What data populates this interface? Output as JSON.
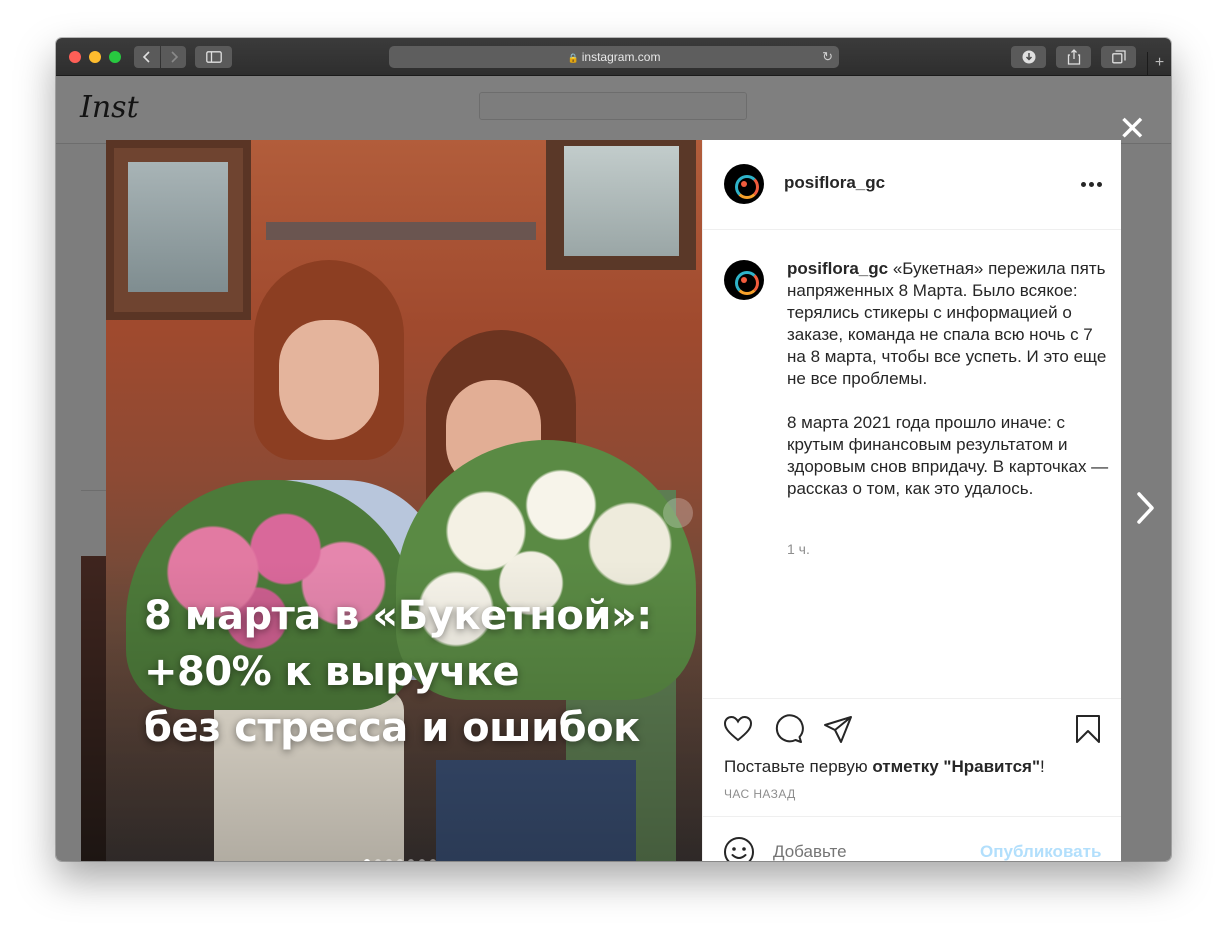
{
  "browser": {
    "url": "instagram.com"
  },
  "page": {
    "logo": "Inst"
  },
  "post": {
    "username": "posiflora_gc",
    "headline": [
      "8 марта в «Букетной»:",
      "+80% к выручке",
      "без стресса и ошибок"
    ],
    "carousel": {
      "total": 7,
      "active": 0
    },
    "caption_username": "posiflora_gc",
    "caption_paragraph1": " «Букетная» пережила пять напряженных 8 Марта. Было всякое: терялись стикеры с информацией о заказе, команда не спала всю ночь с 7 на 8 марта, чтобы все успеть. И это еще не все проблемы.",
    "caption_paragraph2": "8 марта 2021 года прошло иначе: с крутым финансовым результатом и здоровым снов впридачу. В карточках — рассказ о том, как это удалось.",
    "time_ago": "1 ч.",
    "likes_prefix": "Поставьте первую ",
    "likes_bold": "отметку \"Нравится\"",
    "likes_suffix": "!",
    "posted_time": "ЧАС НАЗАД",
    "comment_placeholder": "Добавьте",
    "publish_label": "Опубликовать"
  },
  "icons": {
    "close": "close-icon",
    "next": "chevron-right-icon",
    "more": "more-icon",
    "like": "heart-icon",
    "comment": "comment-icon",
    "share": "paper-plane-icon",
    "save": "bookmark-icon",
    "emoji": "emoji-icon"
  },
  "colors": {
    "publish": "#b2dffc",
    "text": "#262626",
    "muted": "#8e8e8e"
  }
}
